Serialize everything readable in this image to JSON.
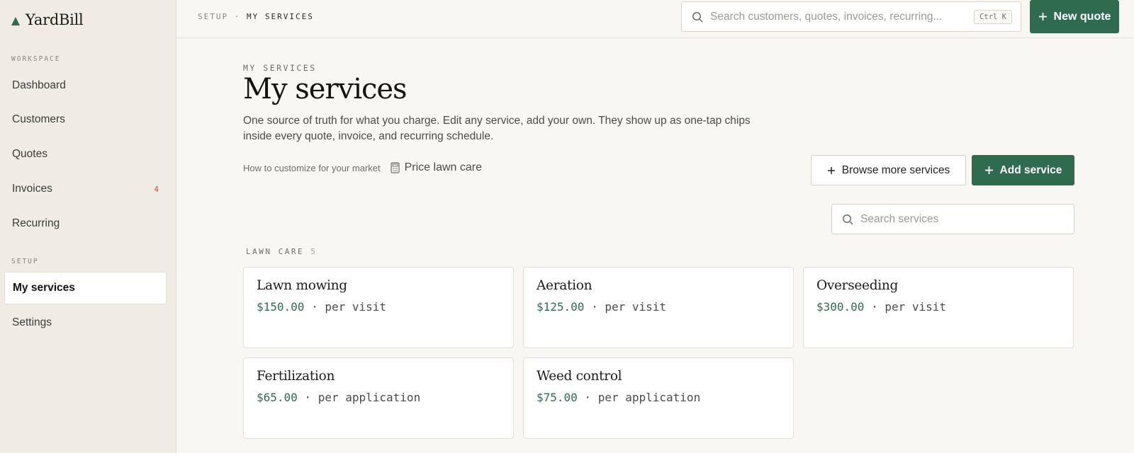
{
  "brand": {
    "name": "YardBill"
  },
  "sidebar": {
    "workspace_label": "WORKSPACE",
    "setup_label": "SETUP",
    "workspace_items": [
      {
        "label": "Dashboard",
        "badge": ""
      },
      {
        "label": "Customers",
        "badge": ""
      },
      {
        "label": "Quotes",
        "badge": ""
      },
      {
        "label": "Invoices",
        "badge": "4"
      },
      {
        "label": "Recurring",
        "badge": ""
      }
    ],
    "setup_items": [
      {
        "label": "My services",
        "active": true
      },
      {
        "label": "Settings",
        "active": false
      }
    ]
  },
  "topbar": {
    "breadcrumb_parent": "SETUP",
    "breadcrumb_sep": "·",
    "breadcrumb_current": "MY SERVICES",
    "search_placeholder": "Search customers, quotes, invoices, recurring...",
    "search_shortcut": "Ctrl K",
    "new_quote_label": "New quote"
  },
  "page": {
    "eyebrow": "MY SERVICES",
    "title": "My services",
    "description": "One source of truth for what you charge. Edit any service, add your own. They show up as one-tap chips inside every quote, invoice, and recurring schedule.",
    "help_link": "How to customize for your market",
    "price_link": "Price lawn care",
    "browse_label": "Browse more services",
    "add_label": "Add service",
    "service_search_placeholder": "Search services"
  },
  "categories": [
    {
      "name": "LAWN CARE",
      "count": "5",
      "services": [
        {
          "name": "Lawn mowing",
          "price": "$150.00",
          "unit": "per visit"
        },
        {
          "name": "Aeration",
          "price": "$125.00",
          "unit": "per visit"
        },
        {
          "name": "Overseeding",
          "price": "$300.00",
          "unit": "per visit"
        },
        {
          "name": "Fertilization",
          "price": "$65.00",
          "unit": "per application"
        },
        {
          "name": "Weed control",
          "price": "$75.00",
          "unit": "per application"
        }
      ]
    }
  ],
  "colors": {
    "accent": "#2f6b4f",
    "badge": "#c2562d",
    "background": "#f8f7f3",
    "sidebar": "#f0ece5"
  },
  "icons": [
    "brand-triangle-icon",
    "search-icon",
    "plus-icon",
    "calculator-icon"
  ]
}
